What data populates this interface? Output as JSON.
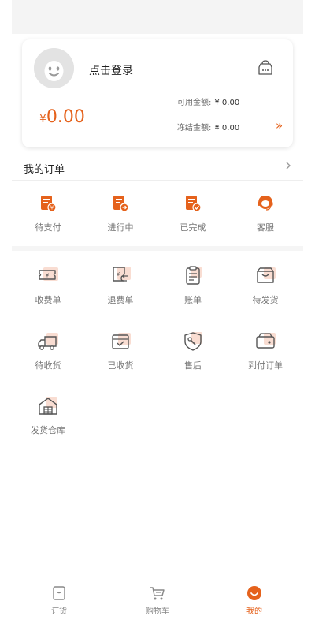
{
  "profile": {
    "login_label": "点击登录",
    "currency_symbol": "¥",
    "balance": "0.00",
    "available_label": "可用金额:",
    "available_value": "¥ 0.00",
    "frozen_label": "冻结金额:",
    "frozen_value": "¥ 0.00",
    "more_symbol": "»"
  },
  "orders": {
    "title": "我的订单",
    "status_items": [
      {
        "label": "待支付",
        "icon": "pending-payment-icon"
      },
      {
        "label": "进行中",
        "icon": "in-progress-icon"
      },
      {
        "label": "已完成",
        "icon": "completed-icon"
      },
      {
        "label": "客服",
        "icon": "customer-service-icon"
      }
    ]
  },
  "grid": {
    "items": [
      {
        "label": "收费单",
        "icon": "charge-ticket-icon"
      },
      {
        "label": "退费单",
        "icon": "refund-icon"
      },
      {
        "label": "账单",
        "icon": "bill-icon"
      },
      {
        "label": "待发货",
        "icon": "to-ship-icon"
      },
      {
        "label": "待收货",
        "icon": "to-receive-icon"
      },
      {
        "label": "已收货",
        "icon": "received-icon"
      },
      {
        "label": "售后",
        "icon": "after-sales-icon"
      },
      {
        "label": "到付订单",
        "icon": "cash-on-delivery-icon"
      },
      {
        "label": "发货仓库",
        "icon": "warehouse-icon"
      }
    ]
  },
  "nav": {
    "items": [
      {
        "label": "订货",
        "icon": "order-icon",
        "active": false
      },
      {
        "label": "购物车",
        "icon": "cart-icon",
        "active": false
      },
      {
        "label": "我的",
        "icon": "profile-icon",
        "active": true
      }
    ]
  },
  "colors": {
    "accent": "#e5621c",
    "accent_light": "#f9ddd2",
    "icon_gray": "#666666"
  }
}
